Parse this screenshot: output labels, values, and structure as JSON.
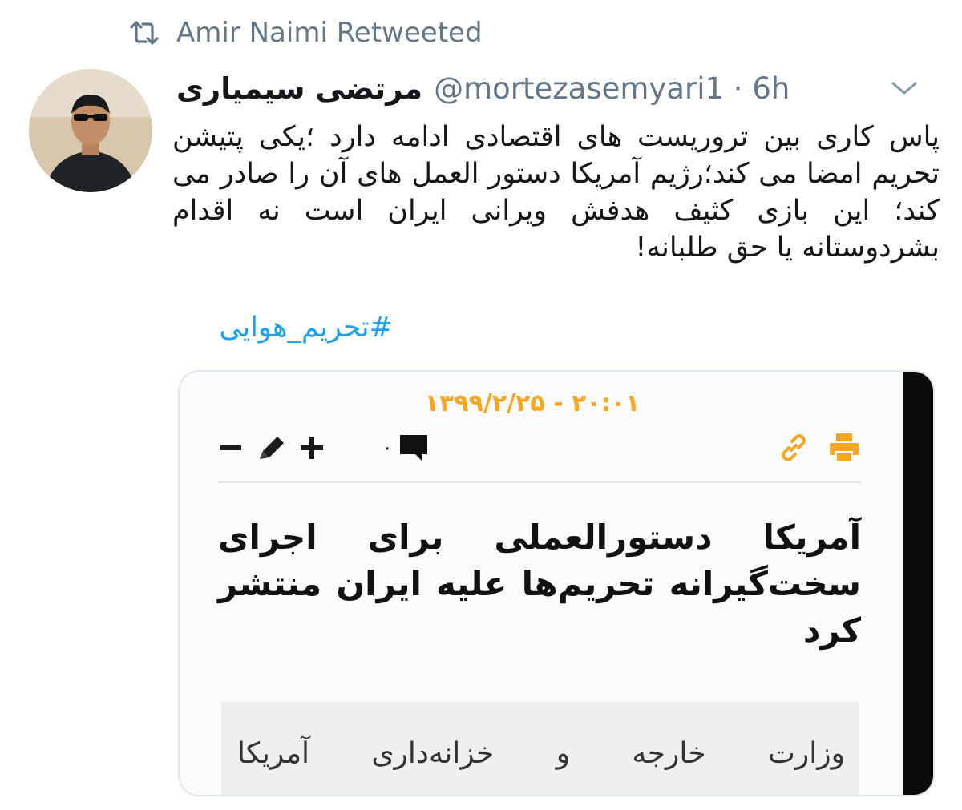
{
  "retweet": {
    "label": "Amir Naimi Retweeted",
    "icon": "retweet-icon"
  },
  "tweet": {
    "display_name": "مرتضی سیمیاری",
    "handle": "@mortezasemyari1 · 6h",
    "text": "پاس کاری بین تروریست های اقتصادی ادامه دارد ؛یکی پتیشن تحریم امضا می کند؛رژیم آمریکا دستور العمل های آن را صادر می کند؛ این بازی کثیف هدفش ویرانی ایران است نه اقدام بشردوستانه یا حق طلبانه!",
    "hashtag": "#تحریم_هوایی",
    "menu_icon": "chevron-down-icon",
    "avatar_icon": "avatar"
  },
  "media": {
    "date": "۱۳۹۹/۲/۲۵ - ۲۰:۰۱",
    "comment_count": "۰",
    "headline": "آمریکا دستورالعملی برای اجرای سخت‌گیرانه تحریم‌ها علیه ایران منتشر کرد",
    "lead": "وزارت خارجه و خزانه‌داری آمریکا",
    "icons": [
      "minus-icon",
      "pencil-icon",
      "plus-icon",
      "comment-icon",
      "link-icon",
      "print-icon"
    ],
    "accent_color": "#f5a623"
  },
  "colors": {
    "link": "#1da1f2",
    "muted": "#657786",
    "text": "#14171a"
  }
}
